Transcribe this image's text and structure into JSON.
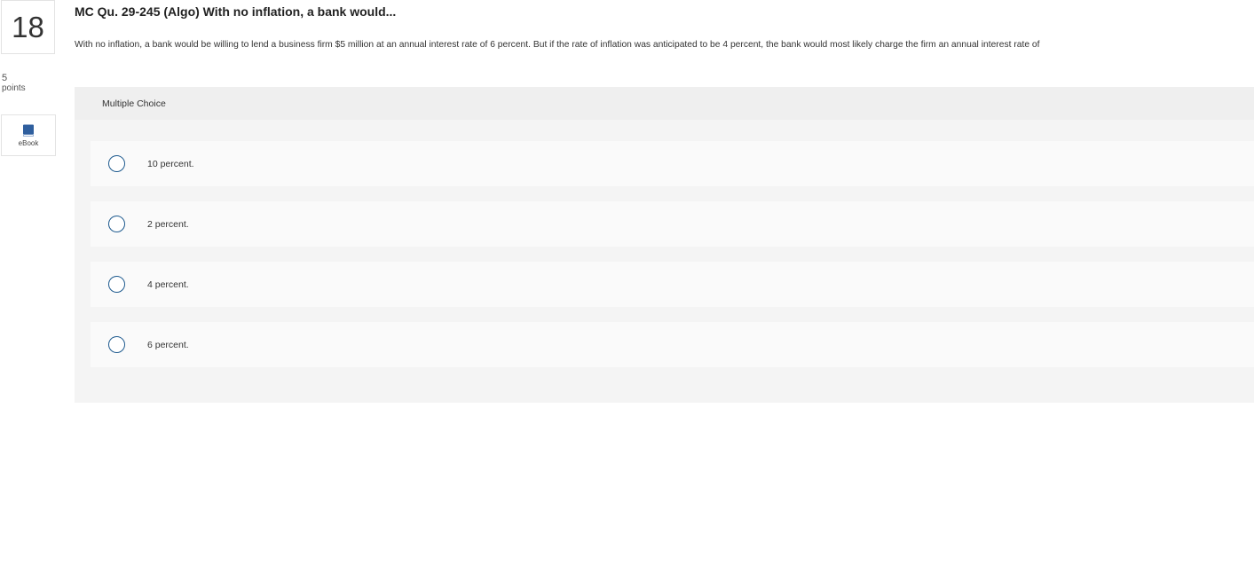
{
  "question": {
    "number": "18",
    "points_value": "5",
    "points_label": "points",
    "title": "MC Qu. 29-245 (Algo) With no inflation, a bank would...",
    "text": "With no inflation, a bank would be willing to lend a business firm $5 million at an annual interest rate of 6 percent. But if the rate of inflation was anticipated to be 4 percent, the bank would most likely charge the firm an annual interest rate of"
  },
  "ebook": {
    "label": "eBook",
    "icon": "book-icon"
  },
  "multiple_choice": {
    "header": "Multiple Choice",
    "options": [
      {
        "label": "10 percent."
      },
      {
        "label": "2 percent."
      },
      {
        "label": "4 percent."
      },
      {
        "label": "6 percent."
      }
    ]
  },
  "colors": {
    "radio_border": "#1e5a8e",
    "ebook_icon": "#2f5f9e",
    "panel_bg": "#f4f4f4",
    "choice_bg": "#fafafa"
  }
}
